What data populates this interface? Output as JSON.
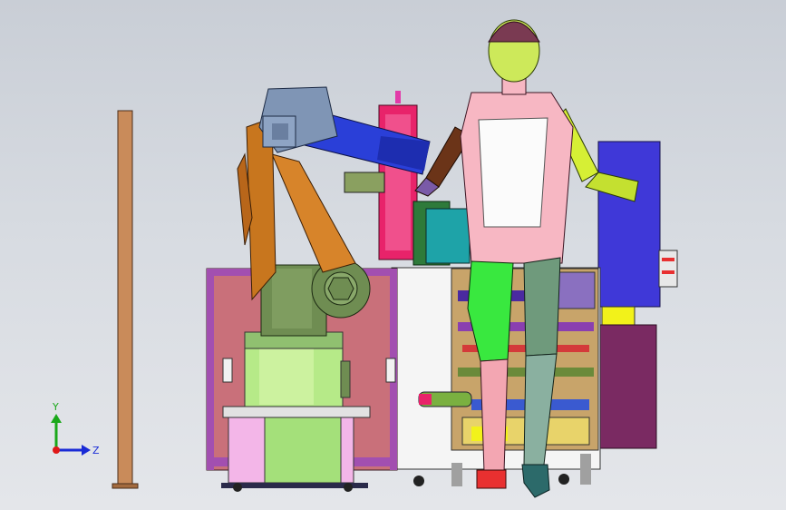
{
  "viewport": {
    "background_top": "#c9ced6",
    "background_bottom": "#e4e6ea"
  },
  "triad": {
    "y_label": "Y",
    "z_label": "Z",
    "y_color": "#1aa81a",
    "z_color": "#1a2bd6",
    "origin_color": "#e01818"
  },
  "colors": {
    "robot_orange": "#c8761e",
    "robot_gear": "#6f8d52",
    "robot_motor": "#7f95b5",
    "robot_arm": "#2a3fd8",
    "base_green": "#b6ea88",
    "cabinet_pink": "#c9707a",
    "cabinet_frame": "#a24fb0",
    "mannequin_torso": "#f7b7c3",
    "mannequin_head": "#cde95a",
    "mannequin_arm_dark": "#6b3418",
    "mannequin_arm_yellow": "#d6ef35",
    "leg_green": "#39e83f",
    "leg_gray": "#6f9a7c",
    "panel_blue": "#3f38d8",
    "panel_purple": "#7a2a62",
    "pole_brown": "#c98b5a"
  }
}
